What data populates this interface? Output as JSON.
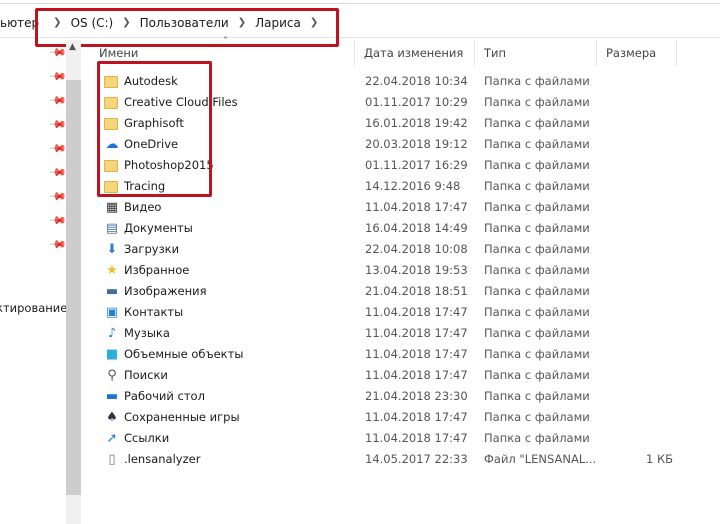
{
  "breadcrumb": {
    "items": [
      "ьютер",
      "OS (C:)",
      "Пользователи",
      "Лариса"
    ]
  },
  "nav_pane": {
    "partial_item": "ктирование"
  },
  "columns": {
    "name": "Имени",
    "date": "Дата изменения",
    "type": "Тип",
    "size": "Размера"
  },
  "highlight_color": "#c1121f",
  "files": [
    {
      "name": "Autodesk",
      "date": "22.04.2018 10:34",
      "type": "Папка с файлами",
      "size": "",
      "icon": "folder-icon"
    },
    {
      "name": "Creative Cloud Files",
      "date": "01.11.2017 10:29",
      "type": "Папка с файлами",
      "size": "",
      "icon": "folder-icon"
    },
    {
      "name": "Graphisoft",
      "date": "16.01.2018 19:42",
      "type": "Папка с файлами",
      "size": "",
      "icon": "folder-icon"
    },
    {
      "name": "OneDrive",
      "date": "20.03.2018 19:12",
      "type": "Папка с файлами",
      "size": "",
      "icon": "cloud-icon"
    },
    {
      "name": "Photoshop2015",
      "date": "01.11.2017 16:29",
      "type": "Папка с файлами",
      "size": "",
      "icon": "folder-icon"
    },
    {
      "name": "Tracing",
      "date": "14.12.2016 9:48",
      "type": "Папка с файлами",
      "size": "",
      "icon": "folder-icon"
    },
    {
      "name": "Видео",
      "date": "11.04.2018 17:47",
      "type": "Папка с файлами",
      "size": "",
      "icon": "video-icon"
    },
    {
      "name": "Документы",
      "date": "16.04.2018 14:49",
      "type": "Папка с файлами",
      "size": "",
      "icon": "document-icon"
    },
    {
      "name": "Загрузки",
      "date": "22.04.2018 10:08",
      "type": "Папка с файлами",
      "size": "",
      "icon": "download-icon"
    },
    {
      "name": "Избранное",
      "date": "13.04.2018 19:53",
      "type": "Папка с файлами",
      "size": "",
      "icon": "star-icon"
    },
    {
      "name": "Изображения",
      "date": "21.04.2018 18:51",
      "type": "Папка с файлами",
      "size": "",
      "icon": "image-icon"
    },
    {
      "name": "Контакты",
      "date": "11.04.2018 17:47",
      "type": "Папка с файлами",
      "size": "",
      "icon": "contacts-icon"
    },
    {
      "name": "Музыка",
      "date": "11.04.2018 17:47",
      "type": "Папка с файлами",
      "size": "",
      "icon": "music-icon"
    },
    {
      "name": "Объемные объекты",
      "date": "11.04.2018 17:47",
      "type": "Папка с файлами",
      "size": "",
      "icon": "cube-icon"
    },
    {
      "name": "Поиски",
      "date": "11.04.2018 17:47",
      "type": "Папка с файлами",
      "size": "",
      "icon": "search-icon"
    },
    {
      "name": "Рабочий стол",
      "date": "21.04.2018 23:30",
      "type": "Папка с файлами",
      "size": "",
      "icon": "desktop-icon"
    },
    {
      "name": "Сохраненные игры",
      "date": "11.04.2018 17:47",
      "type": "Папка с файлами",
      "size": "",
      "icon": "games-icon"
    },
    {
      "name": "Ссылки",
      "date": "11.04.2018 17:47",
      "type": "Папка с файлами",
      "size": "",
      "icon": "link-icon"
    },
    {
      "name": ".lensanalyzer",
      "date": "14.05.2017 22:33",
      "type": "Файл \"LENSANAL...",
      "size": "1 КБ",
      "icon": "file-icon"
    }
  ]
}
